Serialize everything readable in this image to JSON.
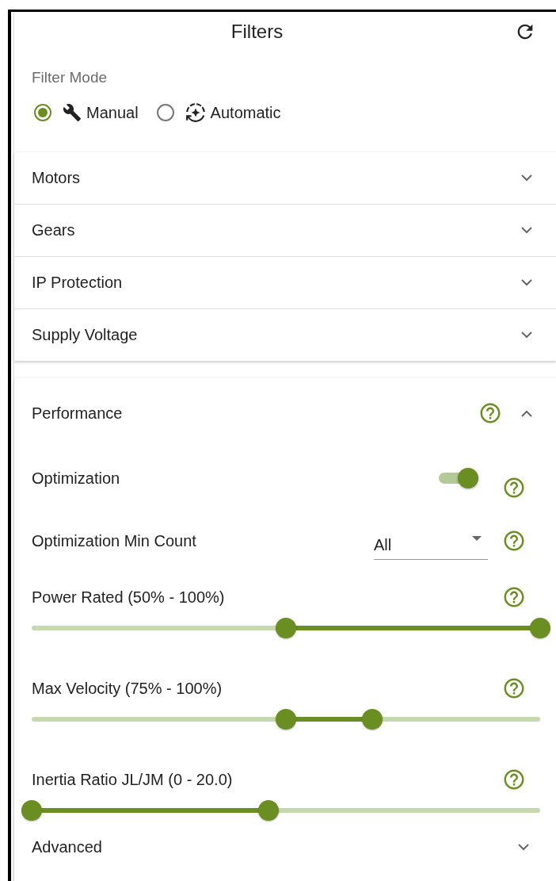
{
  "header": {
    "title": "Filters"
  },
  "filter_mode": {
    "label": "Filter Mode",
    "options": [
      {
        "kind": "manual",
        "label": "Manual",
        "selected": true
      },
      {
        "kind": "automatic",
        "label": "Automatic",
        "selected": false
      }
    ]
  },
  "sections": [
    {
      "title": "Motors",
      "expanded": false
    },
    {
      "title": "Gears",
      "expanded": false
    },
    {
      "title": "IP Protection",
      "expanded": false
    },
    {
      "title": "Supply Voltage",
      "expanded": false
    }
  ],
  "performance": {
    "title": "Performance",
    "expanded": true,
    "items": [
      {
        "kind": "toggle",
        "label": "Optimization",
        "on": true
      },
      {
        "kind": "select",
        "label": "Optimization Min Count",
        "value": "All"
      },
      {
        "kind": "range",
        "label": "Power Rated (50% - 100%)",
        "thumbs": [
          {
            "level": 0.5
          },
          {
            "level": 1
          }
        ]
      },
      {
        "kind": "range",
        "label": "Max Velocity (75% - 100%)",
        "thumbs": [
          {
            "level": 0.5
          },
          {
            "level": 0.67
          }
        ]
      },
      {
        "kind": "range",
        "label": "Inertia Ratio JL/JM (0 - 20.0)",
        "thumbs": [
          {
            "level": 0
          },
          {
            "level": 0.466
          }
        ]
      }
    ]
  },
  "advanced": {
    "title": "Advanced",
    "expanded": false
  }
}
